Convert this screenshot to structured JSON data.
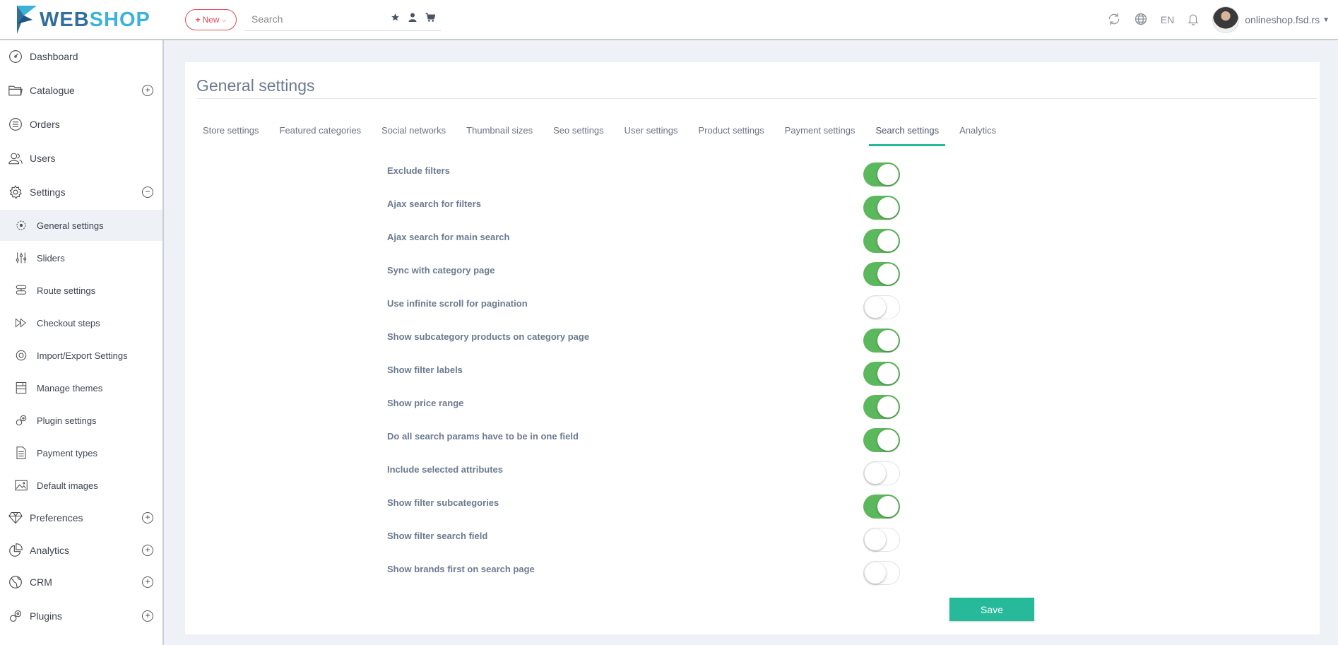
{
  "header": {
    "logo": {
      "text_a": "WEB",
      "text_b": "SHOP"
    },
    "new_button": "New",
    "search_placeholder": "Search",
    "language": "EN",
    "user_name": "onlineshop.fsd.rs"
  },
  "sidebar": {
    "items": [
      {
        "label": "Dashboard",
        "icon": "dashboard-icon",
        "expandable": false
      },
      {
        "label": "Catalogue",
        "icon": "folder-icon",
        "expandable": true,
        "state": "⊕"
      },
      {
        "label": "Orders",
        "icon": "list-icon",
        "expandable": false
      },
      {
        "label": "Users",
        "icon": "users-icon",
        "expandable": false
      },
      {
        "label": "Settings",
        "icon": "gear-icon",
        "expandable": true,
        "state": "⊖"
      }
    ],
    "sub_items": [
      {
        "label": "General settings",
        "icon": "general-settings-icon",
        "active": true
      },
      {
        "label": "Sliders",
        "icon": "sliders-icon"
      },
      {
        "label": "Route settings",
        "icon": "route-icon"
      },
      {
        "label": "Checkout steps",
        "icon": "checkout-icon"
      },
      {
        "label": "Import/Export Settings",
        "icon": "import-export-icon"
      },
      {
        "label": "Manage themes",
        "icon": "themes-icon"
      },
      {
        "label": "Plugin settings",
        "icon": "plugin-settings-icon"
      },
      {
        "label": "Payment types",
        "icon": "payment-icon"
      },
      {
        "label": "Default images",
        "icon": "image-icon"
      }
    ],
    "bottom_items": [
      {
        "label": "Preferences",
        "icon": "diamond-icon",
        "state": "⊕"
      },
      {
        "label": "Analytics",
        "icon": "pie-chart-icon",
        "state": "⊕"
      },
      {
        "label": "CRM",
        "icon": "globe-icon",
        "state": "⊕"
      },
      {
        "label": "Plugins",
        "icon": "plugins-icon",
        "state": "⊕"
      }
    ]
  },
  "main": {
    "title": "General settings",
    "tabs": [
      {
        "label": "Store settings",
        "active": false
      },
      {
        "label": "Featured categories",
        "active": false
      },
      {
        "label": "Social networks",
        "active": false
      },
      {
        "label": "Thumbnail sizes",
        "active": false
      },
      {
        "label": "Seo settings",
        "active": false
      },
      {
        "label": "User settings",
        "active": false
      },
      {
        "label": "Product settings",
        "active": false
      },
      {
        "label": "Payment settings",
        "active": false
      },
      {
        "label": "Search settings",
        "active": true
      },
      {
        "label": "Analytics",
        "active": false
      }
    ],
    "settings": [
      {
        "label": "Exclude filters",
        "on": true
      },
      {
        "label": "Ajax search for filters",
        "on": true
      },
      {
        "label": "Ajax search for main search",
        "on": true
      },
      {
        "label": "Sync with category page",
        "on": true
      },
      {
        "label": "Use infinite scroll for pagination",
        "on": false
      },
      {
        "label": "Show subcategory products on category page",
        "on": true
      },
      {
        "label": "Show filter labels",
        "on": true
      },
      {
        "label": "Show price range",
        "on": true
      },
      {
        "label": "Do all search params have to be in one field",
        "on": true
      },
      {
        "label": "Include selected attributes",
        "on": false
      },
      {
        "label": "Show filter subcategories",
        "on": true
      },
      {
        "label": "Show filter search field",
        "on": false
      },
      {
        "label": "Show brands first on search page",
        "on": false
      }
    ],
    "save_label": "Save"
  },
  "colors": {
    "accent": "#26b99a",
    "toggle_on": "#5cb85c",
    "new_button": "#e04b59",
    "logo_dark": "#2f6e9e",
    "logo_light": "#3bb3d8"
  }
}
